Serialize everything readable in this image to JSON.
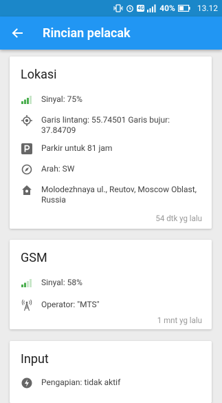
{
  "status_bar": {
    "network": "4G",
    "battery": "40%",
    "time": "13.12"
  },
  "toolbar": {
    "title": "Rincian pelacak"
  },
  "cards": {
    "location": {
      "title": "Lokasi",
      "signal": "Sinyal: 75%",
      "coordinates": "Garis lintang: 55.74501 Garis bujur: 37.84709",
      "parking": "Parkir untuk 81 jam",
      "direction": "Arah: SW",
      "address": "Molodezhnaya ul., Reutov, Moscow Oblast, Russia",
      "time": "54 dtk yg lalu"
    },
    "gsm": {
      "title": "GSM",
      "signal": "Sinyal: 58%",
      "operator": "Operator: \"MTS\"",
      "time": "1 mnt yg lalu"
    },
    "input": {
      "title": "Input",
      "ignition": "Pengapian: tidak aktif"
    }
  },
  "colors": {
    "status_bar": "#1b87c9",
    "toolbar": "#2196f3",
    "signal_green": "#4caf50",
    "icon_gray": "#666666"
  }
}
